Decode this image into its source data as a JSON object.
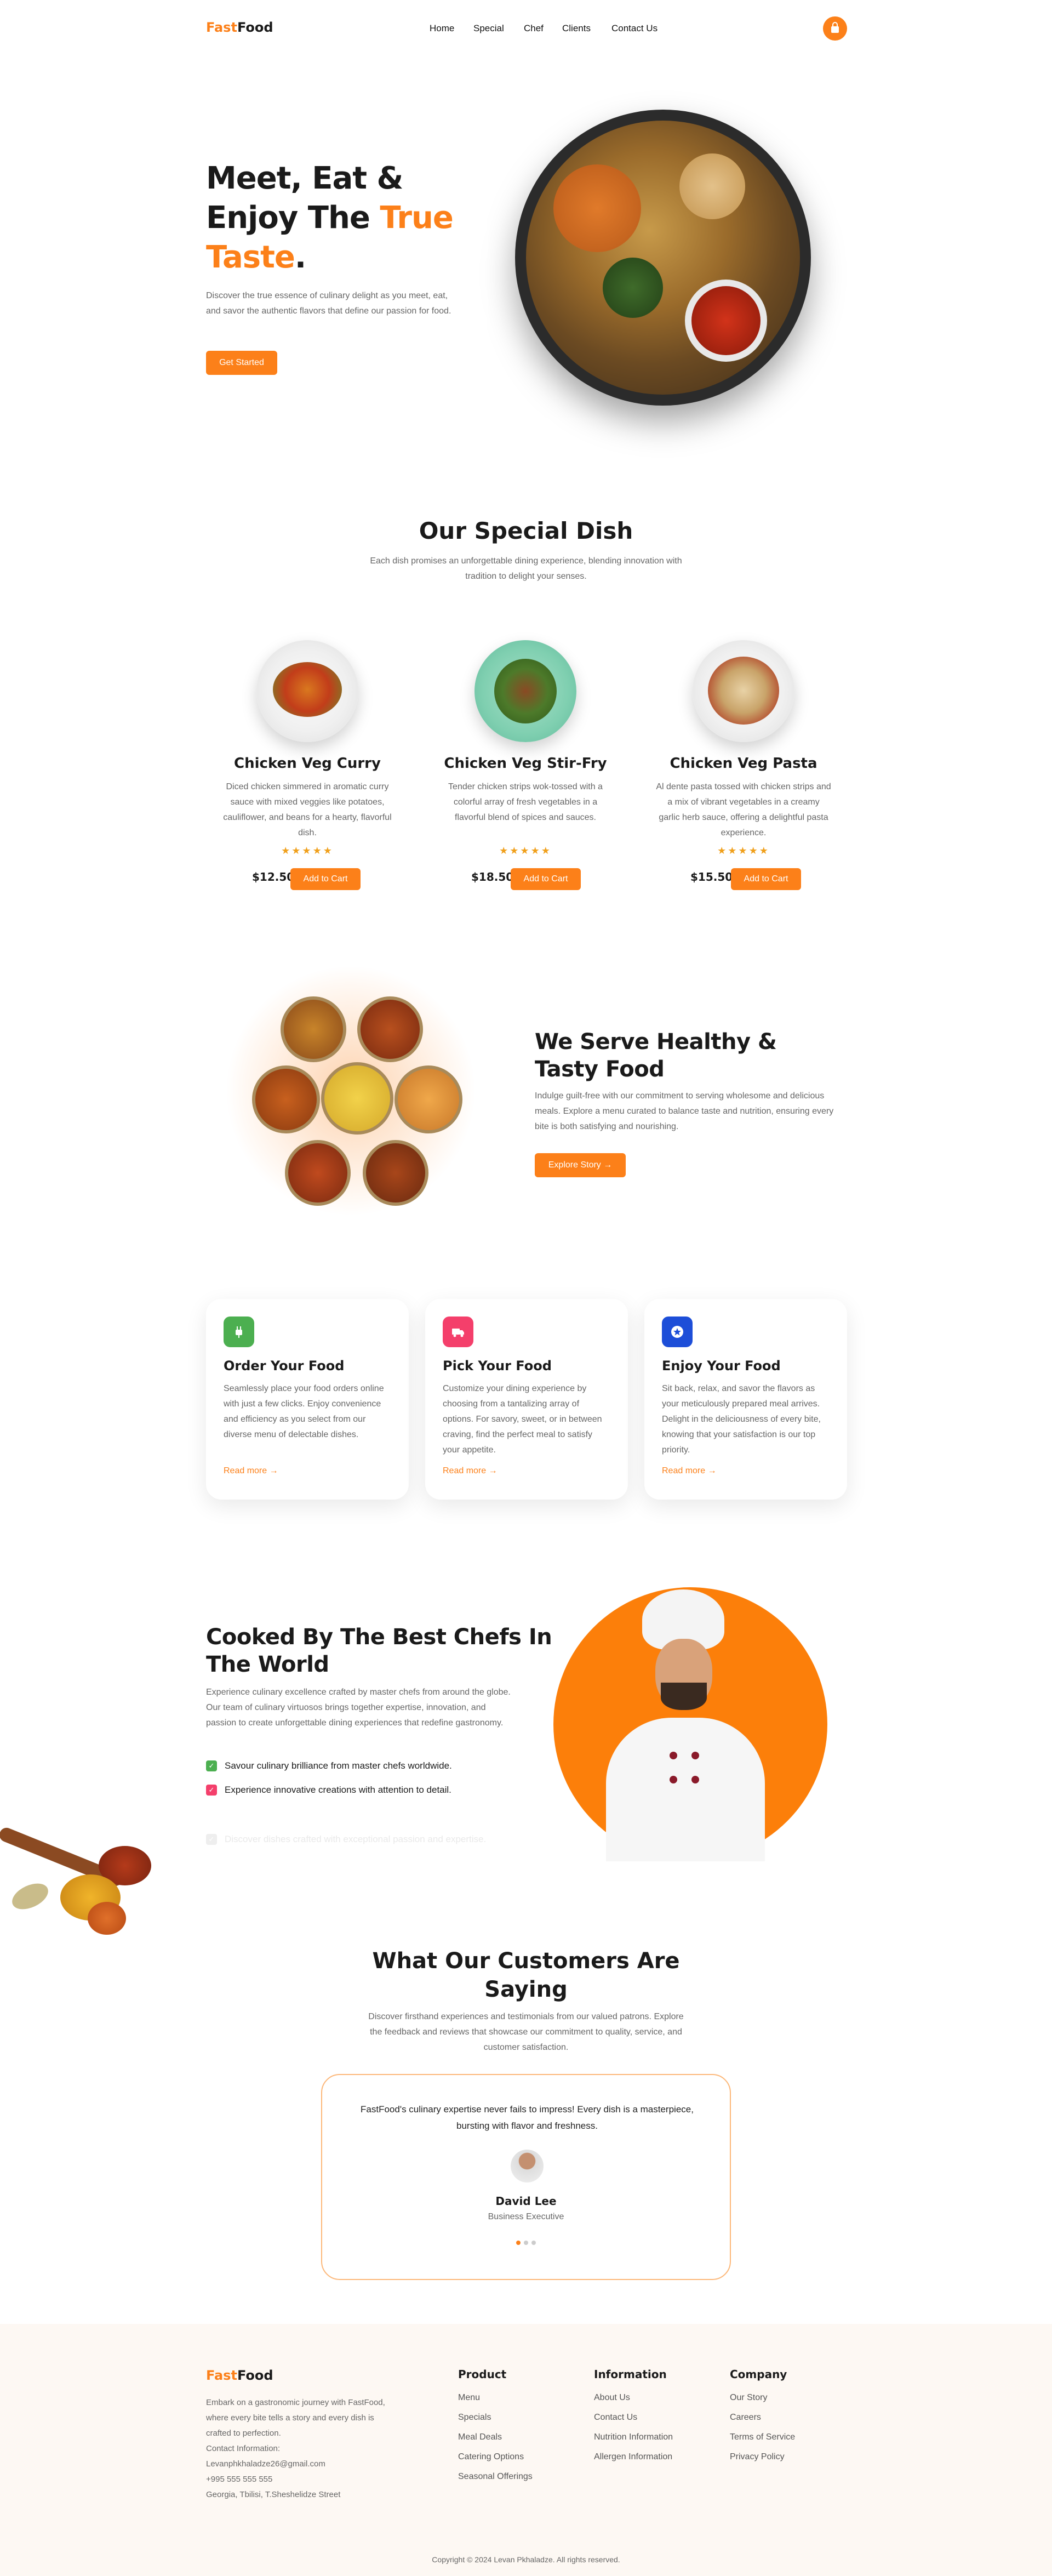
{
  "header": {
    "logo_part1": "Fast",
    "logo_part2": "Food",
    "nav": [
      "Home",
      "Special",
      "Chef",
      "Clients",
      "Contact Us"
    ],
    "cart_icon": "shopping-bag-icon"
  },
  "hero": {
    "line1": "Meet, Eat &",
    "line2": "Enjoy The",
    "line2_accent": "True",
    "line3_accent": "Taste",
    "line3_end": ".",
    "description": "Discover the true essence of culinary delight as you meet, eat, and savor the authentic flavors that define our passion for food.",
    "cta": "Get Started"
  },
  "special": {
    "title": "Our Special Dish",
    "subtitle": "Each dish promises an unforgettable dining experience, blending innovation with tradition to delight your senses.",
    "dishes": [
      {
        "name": "Chicken Veg Curry",
        "desc": "Diced chicken simmered in aromatic curry sauce with mixed veggies like potatoes, cauliflower, and beans for a hearty, flavorful dish.",
        "stars": "★★★★★",
        "rating": 5,
        "price": "$12.50",
        "cta": "Add to Cart"
      },
      {
        "name": "Chicken Veg Stir-Fry",
        "desc": "Tender chicken strips wok-tossed with a colorful array of fresh vegetables in a flavorful blend of spices and sauces.",
        "stars": "★★★★★",
        "rating": 5,
        "price": "$18.50",
        "cta": "Add to Cart"
      },
      {
        "name": "Chicken Veg Pasta",
        "desc": "Al dente pasta tossed with chicken strips and a mix of vibrant vegetables in a creamy garlic herb sauce, offering a delightful pasta experience.",
        "stars": "★★★★★",
        "rating": 5,
        "price": "$15.50",
        "cta": "Add to Cart"
      }
    ]
  },
  "healthy": {
    "title_line1": "We Serve Healthy &",
    "title_line2": "Tasty Food",
    "description": "Indulge guilt-free with our commitment to serving wholesome and delicious meals. Explore a menu curated to balance taste and nutrition, ensuring every bite is both satisfying and nourishing.",
    "cta": "Explore Story →"
  },
  "features": [
    {
      "title": "Order Your Food",
      "desc": "Seamlessly place your food orders online with just a few clicks. Enjoy convenience and efficiency as you select from our diverse menu of delectable dishes.",
      "link": "Read more →",
      "icon": "plug-icon",
      "color": "#4caf50"
    },
    {
      "title": "Pick Your Food",
      "desc": "Customize your dining experience by choosing from a tantalizing array of options. For savory, sweet, or in between craving, find the perfect meal to satisfy your appetite.",
      "link": "Read more →",
      "icon": "delivery-truck-icon",
      "color": "#f43f6b"
    },
    {
      "title": "Enjoy Your Food",
      "desc": "Sit back, relax, and savor the flavors as your meticulously prepared meal arrives. Delight in the deliciousness of every bite, knowing that your satisfaction is our top priority.",
      "link": "Read more →",
      "icon": "star-badge-icon",
      "color": "#1d4ed8"
    }
  ],
  "chefs": {
    "title_line1": "Cooked By The Best Chefs In",
    "title_line2": "The World",
    "description": "Experience culinary excellence crafted by master chefs from around the globe. Our team of culinary virtuosos brings together expertise, innovation, and passion to create unforgettable dining experiences that redefine gastronomy.",
    "points": [
      {
        "text": "Savour culinary brilliance from master chefs worldwide.",
        "color": "#4caf50"
      },
      {
        "text": "Experience innovative creations with attention to detail.",
        "color": "#f43f6b"
      },
      {
        "text": "Discover dishes crafted with exceptional passion and expertise.",
        "color": "#e5e5e5"
      }
    ]
  },
  "testimonials": {
    "title_line1": "What Our Customers Are",
    "title_line2": "Saying",
    "subtitle": "Discover firsthand experiences and testimonials from our valued patrons. Explore the feedback and reviews that showcase our commitment to quality, service, and customer satisfaction.",
    "quote": "FastFood's culinary expertise never fails to impress! Every dish is a masterpiece, bursting with flavor and freshness.",
    "name": "David Lee",
    "role": "Business Executive",
    "active_slide": 1,
    "slide_count": 3
  },
  "footer": {
    "logo_part1": "Fast",
    "logo_part2": "Food",
    "about": "Embark on a gastronomic journey with FastFood, where every bite tells a story and every dish is crafted to perfection.",
    "contact_label": "Contact Information:",
    "email": "Levanphkhaladze26@gmail.com",
    "phone": "+995 555 555 555",
    "address": "Georgia, Tbilisi, T.Sheshelidze Street",
    "columns": [
      {
        "title": "Product",
        "links": [
          "Menu",
          "Specials",
          "Meal Deals",
          "Catering Options",
          "Seasonal Offerings"
        ]
      },
      {
        "title": "Information",
        "links": [
          "About Us",
          "Contact Us",
          "Nutrition Information",
          "Allergen Information"
        ]
      },
      {
        "title": "Company",
        "links": [
          "Our Story",
          "Careers",
          "Terms of Service",
          "Privacy Policy"
        ]
      }
    ],
    "copyright": "Copyright © 2024 Levan Pkhaladze. All rights reserved."
  }
}
